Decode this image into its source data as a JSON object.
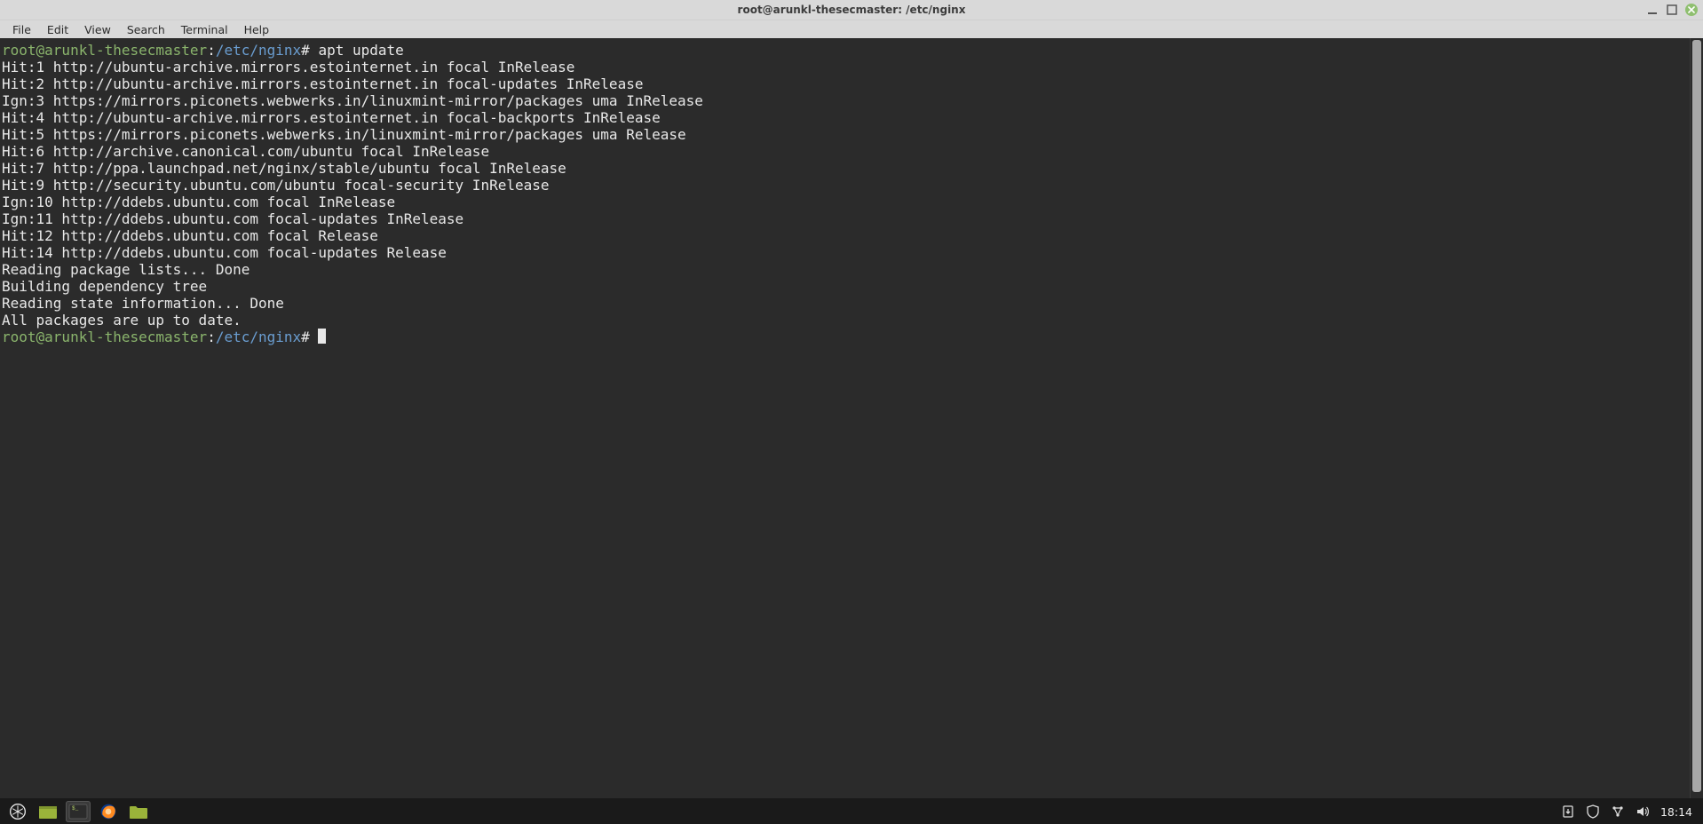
{
  "titlebar": {
    "title": "root@arunkl-thesecmaster: /etc/nginx"
  },
  "menubar": {
    "items": [
      "File",
      "Edit",
      "View",
      "Search",
      "Terminal",
      "Help"
    ]
  },
  "terminal": {
    "prompt_user": "root@arunkl-thesecmaster",
    "prompt_sep": ":",
    "prompt_path": "/etc/nginx",
    "prompt_end": "#",
    "command": "apt update",
    "lines": [
      "Hit:1 http://ubuntu-archive.mirrors.estointernet.in focal InRelease",
      "Hit:2 http://ubuntu-archive.mirrors.estointernet.in focal-updates InRelease",
      "Ign:3 https://mirrors.piconets.webwerks.in/linuxmint-mirror/packages uma InRelease",
      "Hit:4 http://ubuntu-archive.mirrors.estointernet.in focal-backports InRelease",
      "Hit:5 https://mirrors.piconets.webwerks.in/linuxmint-mirror/packages uma Release",
      "Hit:6 http://archive.canonical.com/ubuntu focal InRelease",
      "Hit:7 http://ppa.launchpad.net/nginx/stable/ubuntu focal InRelease",
      "Hit:9 http://security.ubuntu.com/ubuntu focal-security InRelease",
      "Ign:10 http://ddebs.ubuntu.com focal InRelease",
      "Ign:11 http://ddebs.ubuntu.com focal-updates InRelease",
      "Hit:12 http://ddebs.ubuntu.com focal Release",
      "Hit:14 http://ddebs.ubuntu.com focal-updates Release",
      "Reading package lists... Done",
      "Building dependency tree",
      "Reading state information... Done",
      "All packages are up to date."
    ]
  },
  "taskbar": {
    "clock": "18:14"
  }
}
